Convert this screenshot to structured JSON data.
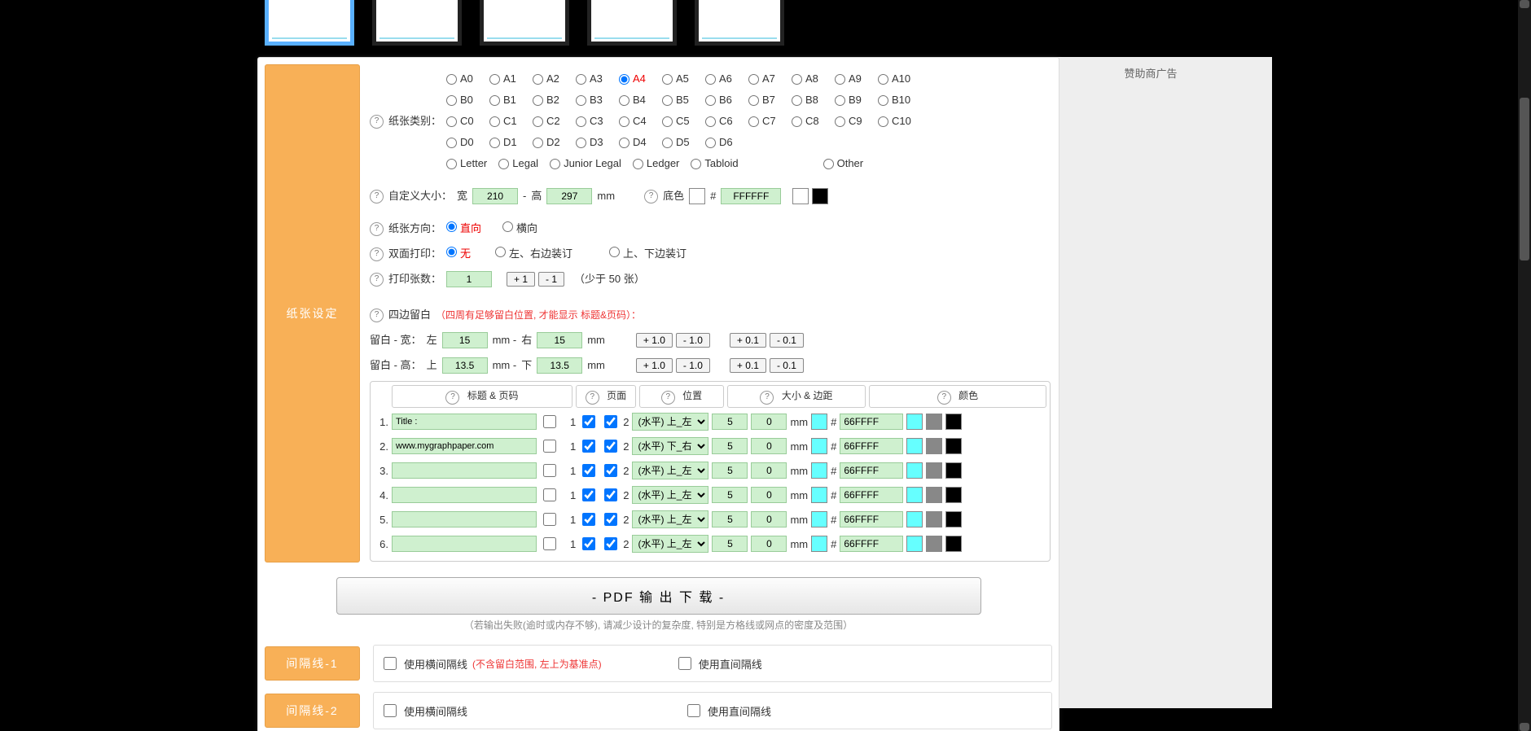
{
  "thumbs_count": 5,
  "labels": {
    "paper_type": "纸张类别：",
    "custom_size": "自定义大小：",
    "width": "宽",
    "height": "高",
    "mm": "mm",
    "bg": "底色",
    "hash": "#",
    "orientation": "纸张方向：",
    "portrait": "直向",
    "landscape": "横向",
    "duplex": "双面打印：",
    "none": "无",
    "lr_bind": "左、右边装订",
    "tb_bind": "上、下边装订",
    "copies": "打印张数：",
    "copies_note": "（少于 50 张）",
    "margins": "四边留白",
    "margins_note": "（四周有足够留白位置, 才能显示 标题&页码）：",
    "margin_w": "留白 - 宽：",
    "left": "左",
    "right": "右",
    "margin_h": "留白 - 高：",
    "top": "上",
    "bottom": "下",
    "p1": "+ 1.0",
    "m1": "- 1.0",
    "p01": "+ 0.1",
    "m01": "- 0.1",
    "plus1": "+ 1",
    "minus1": "- 1",
    "th_title": "标题 & 页码",
    "th_page": "页面",
    "th_pos": "位置",
    "th_size": "大小 & 边距",
    "th_color": "颜色",
    "download": "- PDF 输 出 下 载 -",
    "dl_note": "（若输出失败(逾时或内存不够), 请减少设计的复杂度, 特别是方格线或网点的密度及范围）",
    "sep1": "间隔线-1",
    "sep2": "间隔线-2",
    "use_h_sep": "使用横间隔线",
    "h_sep_note": "(不含留白范围, 左上为基准点)",
    "use_v_sep": "使用直间隔线",
    "side_paper": "纸张设定",
    "sponsor": "赞助商广告"
  },
  "paper_rows": [
    [
      "A0",
      "A1",
      "A2",
      "A3",
      "A4",
      "A5",
      "A6",
      "A7",
      "A8",
      "A9",
      "A10"
    ],
    [
      "B0",
      "B1",
      "B2",
      "B3",
      "B4",
      "B5",
      "B6",
      "B7",
      "B8",
      "B9",
      "B10"
    ],
    [
      "C0",
      "C1",
      "C2",
      "C3",
      "C4",
      "C5",
      "C6",
      "C7",
      "C8",
      "C9",
      "C10"
    ],
    [
      "D0",
      "D1",
      "D2",
      "D3",
      "D4",
      "D5",
      "D6"
    ]
  ],
  "paper_special": [
    "Letter",
    "Legal",
    "Junior Legal",
    "Ledger",
    "Tabloid"
  ],
  "paper_other": "Other",
  "paper_selected": "A4",
  "size": {
    "w": "210",
    "h": "297"
  },
  "bg_hex": "FFFFFF",
  "copies": "1",
  "margins": {
    "l": "15",
    "r": "15",
    "t": "13.5",
    "b": "13.5"
  },
  "pos_default": "(水平) 上_左",
  "pos_row2": "(水平) 下_右",
  "title_rows": [
    {
      "idx": "1.",
      "title": "Title :",
      "size": "5",
      "margin": "0",
      "hex": "66FFFF"
    },
    {
      "idx": "2.",
      "title": "www.mygraphpaper.com",
      "size": "5",
      "margin": "0",
      "hex": "66FFFF"
    },
    {
      "idx": "3.",
      "title": "",
      "size": "5",
      "margin": "0",
      "hex": "66FFFF"
    },
    {
      "idx": "4.",
      "title": "",
      "size": "5",
      "margin": "0",
      "hex": "66FFFF"
    },
    {
      "idx": "5.",
      "title": "",
      "size": "5",
      "margin": "0",
      "hex": "66FFFF"
    },
    {
      "idx": "6.",
      "title": "",
      "size": "5",
      "margin": "0",
      "hex": "66FFFF"
    }
  ]
}
